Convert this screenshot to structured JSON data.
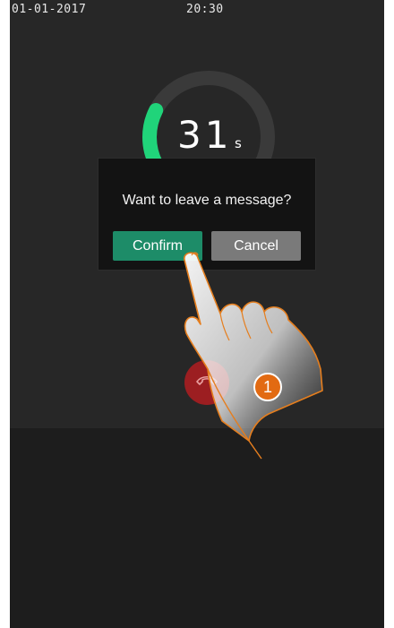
{
  "status_bar": {
    "date": "01-01-2017",
    "time": "20:30"
  },
  "timer": {
    "value": "31",
    "unit": "s",
    "progress_fraction": 0.15,
    "accent_color": "#20d47a"
  },
  "dialog": {
    "message": "Want to leave a message?",
    "confirm_label": "Confirm",
    "cancel_label": "Cancel",
    "confirm_color": "#1d8c68",
    "cancel_color": "#7a7a7a"
  },
  "hangup_button": {
    "icon": "hangup-phone-icon",
    "color": "#9c1e21"
  },
  "instruction": {
    "step_number": "1",
    "badge_color": "#e26a12",
    "hand_icon": "pointing-hand-icon"
  }
}
